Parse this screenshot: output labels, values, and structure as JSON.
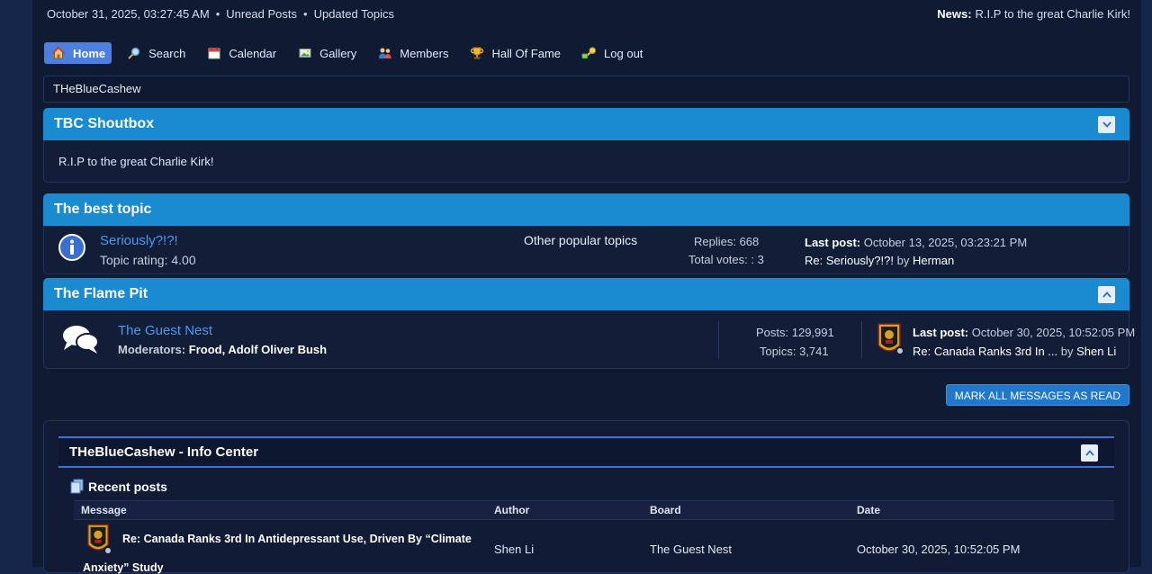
{
  "topbar": {
    "datetime": "October 31, 2025, 03:27:45 AM",
    "links": [
      "Unread Posts",
      "Updated Topics"
    ],
    "news_label": "News:",
    "news_text": "R.I.P to the great Charlie Kirk!"
  },
  "menu": [
    {
      "label": "Home",
      "icon": "home-icon",
      "active": true
    },
    {
      "label": "Search",
      "icon": "search-icon"
    },
    {
      "label": "Calendar",
      "icon": "calendar-icon"
    },
    {
      "label": "Gallery",
      "icon": "gallery-icon"
    },
    {
      "label": "Members",
      "icon": "members-icon"
    },
    {
      "label": "Hall Of Fame",
      "icon": "trophy-icon"
    },
    {
      "label": "Log out",
      "icon": "key-icon"
    }
  ],
  "breadcrumb": "THeBlueCashew",
  "shoutbox": {
    "title": "TBC Shoutbox",
    "message": "R.I.P to the great Charlie Kirk!"
  },
  "best_topic": {
    "title": "The best topic",
    "topic": "Seriously?!?!",
    "rating": "Topic rating: 4.00",
    "other": "Other popular topics",
    "replies": "Replies: 668",
    "votes": "Total votes: : 3",
    "last_post_label": "Last post:",
    "last_post_date": "October 13, 2025, 03:23:21 PM",
    "last_post_re": "Re: Seriously?!?!",
    "last_post_by": "by",
    "last_post_author": "Herman"
  },
  "flame_pit": {
    "title": "The Flame Pit",
    "board": "The Guest Nest",
    "moderators_label": "Moderators:",
    "moderators": "Frood, Adolf Oliver Bush",
    "posts": "Posts: 129,991",
    "topics": "Topics: 3,741",
    "last_post_label": "Last post:",
    "last_post_date": "October 30, 2025, 10:52:05 PM",
    "last_post_re": "Re: Canada Ranks 3rd In ...",
    "last_post_by": "by",
    "last_post_author": "Shen Li"
  },
  "mark_read": "MARK ALL MESSAGES AS READ",
  "info_center": {
    "title": "THeBlueCashew - Info Center",
    "recent_posts": "Recent posts",
    "columns": [
      "Message",
      "Author",
      "Board",
      "Date"
    ],
    "rows": [
      {
        "message": "Re: Canada Ranks 3rd In Antidepressant Use, Driven By “Climate",
        "message_cont": "Anxiety” Study",
        "author": "Shen Li",
        "board": "The Guest Nest",
        "date": "October 30, 2025, 10:52:05 PM"
      }
    ]
  }
}
